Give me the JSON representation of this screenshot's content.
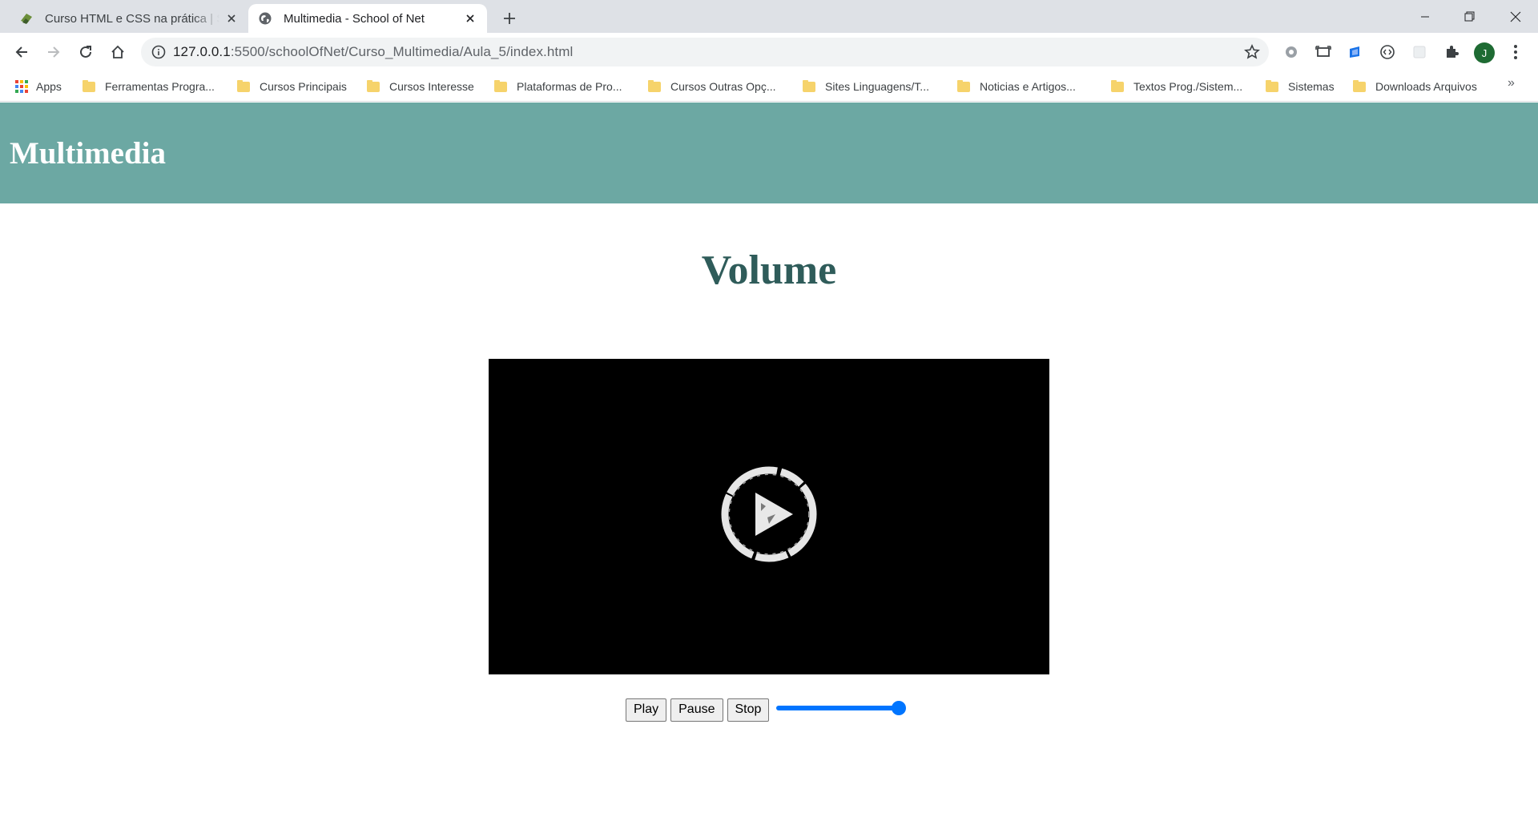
{
  "browser": {
    "tabs": [
      {
        "title": "Curso HTML e CSS na prática | School of Net",
        "active": false,
        "favicon": "school-of-net-icon"
      },
      {
        "title": "Multimedia - School of Net",
        "active": true,
        "favicon": "globe-icon"
      }
    ],
    "url": {
      "host": "127.0.0.1",
      "rest": ":5500/schoolOfNet/Curso_Multimedia/Aula_5/index.html"
    },
    "profile_initial": "J",
    "bookmarks": [
      {
        "label": "Apps",
        "icon": "apps-grid-icon"
      },
      {
        "label": "Ferramentas Progra...",
        "icon": "folder-icon"
      },
      {
        "label": "Cursos Principais",
        "icon": "folder-icon"
      },
      {
        "label": "Cursos Interesse",
        "icon": "folder-icon"
      },
      {
        "label": "Plataformas de Pro...",
        "icon": "folder-icon"
      },
      {
        "label": "Cursos Outras Opç...",
        "icon": "folder-icon"
      },
      {
        "label": "Sites Linguagens/T...",
        "icon": "folder-icon"
      },
      {
        "label": "Noticias e Artigos...",
        "icon": "folder-icon"
      },
      {
        "label": "Textos Prog./Sistem...",
        "icon": "folder-icon"
      },
      {
        "label": "Sistemas",
        "icon": "folder-icon"
      },
      {
        "label": "Downloads Arquivos",
        "icon": "folder-icon"
      }
    ],
    "bookmarks_overflow": "»",
    "colors": {
      "tabstrip": "#dee1e6",
      "folder": "#f6d36b",
      "profile": "#1e6b33"
    }
  },
  "page": {
    "header_title": "Multimedia",
    "section_title": "Volume",
    "video": {
      "poster_icon": "play-circle-icon"
    },
    "controls": {
      "play_label": "Play",
      "pause_label": "Pause",
      "stop_label": "Stop",
      "volume_fraction": 1.0
    },
    "colors": {
      "header_bg": "#6ca8a3",
      "section_title": "#2f5c5a",
      "video_bg": "#000000",
      "range_accent": "#0075ff"
    }
  }
}
